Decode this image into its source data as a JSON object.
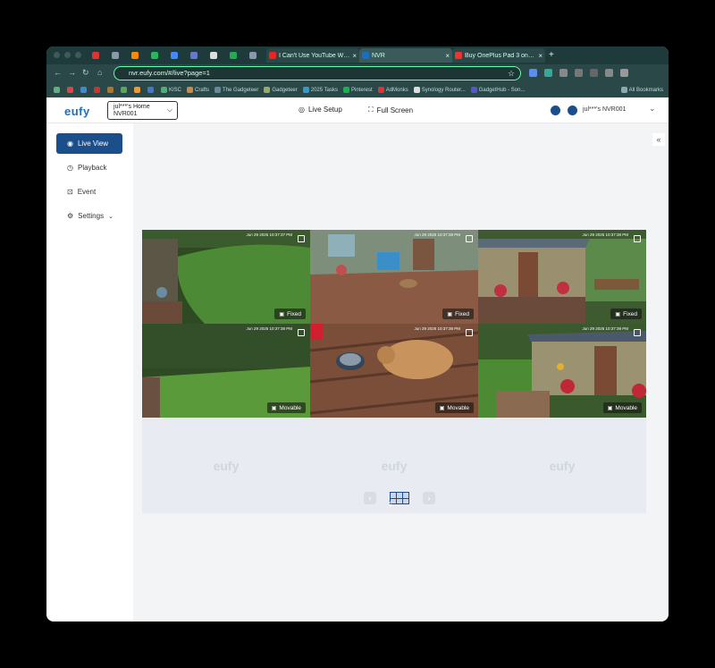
{
  "browser": {
    "tabs": [
      {
        "title": "",
        "color": "#d33"
      },
      {
        "title": "",
        "color": "#89a"
      },
      {
        "title": "",
        "color": "#f80"
      },
      {
        "title": "",
        "color": "#2b5"
      },
      {
        "title": "",
        "color": "#48f"
      },
      {
        "title": "",
        "color": "#67c"
      },
      {
        "title": "",
        "color": "#ddd"
      },
      {
        "title": "",
        "color": "#2a5"
      },
      {
        "title": "",
        "color": "#89a"
      }
    ],
    "wide_tabs": [
      {
        "title": "I Can't Use YouTube Without...",
        "color": "#e22",
        "close": "×",
        "active": false
      },
      {
        "title": "NVR",
        "color": "#1b6fc2",
        "close": "×",
        "active": true
      },
      {
        "title": "Buy OnePlus Pad 3 online | O...",
        "color": "#e33",
        "close": "×",
        "active": false
      }
    ],
    "new_tab": "+",
    "url": "nvr.eufy.com/#/live?page=1",
    "bookmarks": [
      "KISC",
      "Crafts",
      "The Gadgeteer",
      "Gadgeteer",
      "2025 Tasks",
      "Pinterest",
      "AdMonks",
      "Synology Router...",
      "GadgetHub - Son..."
    ],
    "all_bookmarks": "All Bookmarks"
  },
  "header": {
    "logo": "eufy",
    "home_line1": "jul***'s Home",
    "home_line2": "NVR001",
    "live_setup": "Live Setup",
    "full_screen": "Full Screen",
    "user": "jul***'s NVR001"
  },
  "sidebar": {
    "live_view": "Live View",
    "playback": "Playback",
    "event": "Event",
    "settings": "Settings"
  },
  "cameras": [
    {
      "timestamp": "Jun 29 2025 10:37:37 PM",
      "mode": "Fixed",
      "scene": "lawn"
    },
    {
      "timestamp": "Jun 29 2025 10:37:38 PM",
      "mode": "Fixed",
      "scene": "porch"
    },
    {
      "timestamp": "Jun 29 2025 10:37:38 PM",
      "mode": "Fixed",
      "scene": "shed"
    },
    {
      "timestamp": "Jun 29 2025 10:37:38 PM",
      "mode": "Movable",
      "scene": "yard"
    },
    {
      "timestamp": "Jun 29 2025 10:37:38 PM",
      "mode": "Movable",
      "scene": "cat"
    },
    {
      "timestamp": "Jun 29 2025 10:37:39 PM",
      "mode": "Movable",
      "scene": "garden"
    }
  ],
  "empty_slot_logo": "eufy",
  "pager": {
    "page": "1",
    "prev": "‹",
    "next": "›"
  },
  "colors": {
    "accent": "#1b4f8c",
    "brand": "#1b6fc2"
  }
}
